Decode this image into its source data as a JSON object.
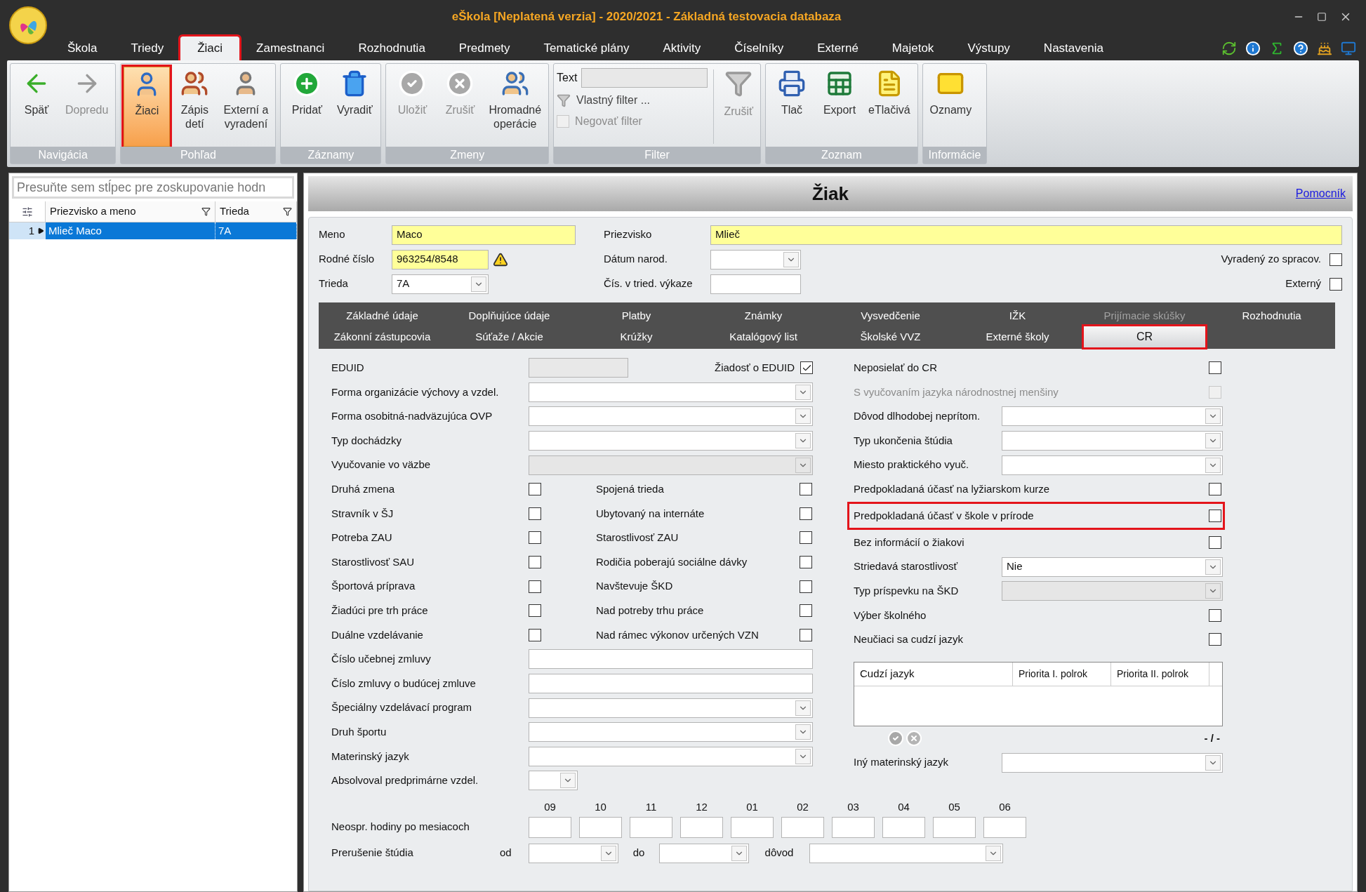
{
  "window": {
    "title": "eŠkola [Neplatená verzia] - 2020/2021 - Základná testovacia databaza"
  },
  "menu": [
    {
      "label": "Škola",
      "selected": false,
      "highlighted": false
    },
    {
      "label": "Triedy",
      "selected": false,
      "highlighted": false
    },
    {
      "label": "Žiaci",
      "selected": true,
      "highlighted": true
    },
    {
      "label": "Zamestnanci",
      "selected": false,
      "highlighted": false
    },
    {
      "label": "Rozhodnutia",
      "selected": false,
      "highlighted": false
    },
    {
      "label": "Predmety",
      "selected": false,
      "highlighted": false
    },
    {
      "label": "Tematické plány",
      "selected": false,
      "highlighted": false
    },
    {
      "label": "Aktivity",
      "selected": false,
      "highlighted": false
    },
    {
      "label": "Číselníky",
      "selected": false,
      "highlighted": false
    },
    {
      "label": "Externé",
      "selected": false,
      "highlighted": false
    },
    {
      "label": "Majetok",
      "selected": false,
      "highlighted": false
    },
    {
      "label": "Výstupy",
      "selected": false,
      "highlighted": false
    },
    {
      "label": "Nastavenia",
      "selected": false,
      "highlighted": false
    }
  ],
  "ribbon": [
    {
      "kind": "buttons",
      "label": "Navigácia",
      "buttons": [
        {
          "label": "Späť",
          "disabled": false,
          "selected": false,
          "highlighted": false
        },
        {
          "label": "Dopredu",
          "disabled": true,
          "selected": false,
          "highlighted": false
        }
      ]
    },
    {
      "kind": "buttons",
      "label": "Pohľad",
      "buttons": [
        {
          "label": "Žiaci",
          "disabled": false,
          "selected": true,
          "highlighted": true
        },
        {
          "label": "Zápis\ndetí",
          "disabled": false,
          "selected": false,
          "highlighted": false
        },
        {
          "label": "Externí a\nvyradení",
          "disabled": false,
          "selected": false,
          "highlighted": false
        }
      ]
    },
    {
      "kind": "buttons",
      "label": "Záznamy",
      "buttons": [
        {
          "label": "Pridať",
          "disabled": false,
          "selected": false,
          "highlighted": false
        },
        {
          "label": "Vyradiť",
          "disabled": false,
          "selected": false,
          "highlighted": false
        }
      ]
    },
    {
      "kind": "buttons",
      "label": "Zmeny",
      "buttons": [
        {
          "label": "Uložiť",
          "disabled": true,
          "selected": false,
          "highlighted": false
        },
        {
          "label": "Zrušiť",
          "disabled": true,
          "selected": false,
          "highlighted": false
        },
        {
          "label": "Hromadné\noperácie",
          "disabled": false,
          "selected": false,
          "highlighted": false
        }
      ]
    },
    {
      "kind": "filter",
      "label": "Filter",
      "text_label": "Text",
      "custom_filter": "Vlastný filter ...",
      "negate": {
        "label": "Negovať filter",
        "checked": false,
        "disabled": true
      },
      "clear": {
        "label": "Zrušiť",
        "disabled": true
      }
    },
    {
      "kind": "buttons",
      "label": "Zoznam",
      "buttons": [
        {
          "label": "Tlač",
          "disabled": false,
          "selected": false,
          "highlighted": false
        },
        {
          "label": "Export",
          "disabled": false,
          "selected": false,
          "highlighted": false
        },
        {
          "label": "eTlačivá",
          "disabled": false,
          "selected": false,
          "highlighted": false
        }
      ]
    },
    {
      "kind": "buttons",
      "label": "Informácie",
      "buttons": [
        {
          "label": "Oznamy",
          "disabled": false,
          "selected": false,
          "highlighted": false
        }
      ]
    }
  ],
  "grid": {
    "group_hint": "Presuňte sem stĺpec pre zoskupovanie hodn",
    "columns": [
      "Priezvisko a meno",
      "Trieda"
    ],
    "rows": [
      {
        "number": "1",
        "cells": [
          "Mlieč Maco",
          "7A"
        ],
        "selected": true
      }
    ]
  },
  "detail": {
    "title": "Žiak",
    "help_link": "Pomocník",
    "header": {
      "first_name": {
        "label": "Meno",
        "value": "Maco"
      },
      "last_name": {
        "label": "Priezvisko",
        "value": "Mlieč"
      },
      "birth_number": {
        "label": "Rodné číslo",
        "value": "963254/8548",
        "warning": true
      },
      "birth_date": {
        "label": "Dátum narod."
      },
      "class": {
        "label": "Trieda",
        "value": "7A"
      },
      "class_number": {
        "label": "Čís. v tried. výkaze"
      },
      "excluded": {
        "label": "Vyradený zo spracov.",
        "checked": false
      },
      "external": {
        "label": "Externý",
        "checked": false
      }
    },
    "tabs": [
      [
        {
          "label": "Základné údaje",
          "selected": false,
          "disabled": false,
          "highlighted": false
        },
        {
          "label": "Doplňujúce údaje",
          "selected": false,
          "disabled": false,
          "highlighted": false
        },
        {
          "label": "Platby",
          "selected": false,
          "disabled": false,
          "highlighted": false
        },
        {
          "label": "Známky",
          "selected": false,
          "disabled": false,
          "highlighted": false
        },
        {
          "label": "Vysvedčenie",
          "selected": false,
          "disabled": false,
          "highlighted": false
        },
        {
          "label": "IŽK",
          "selected": false,
          "disabled": false,
          "highlighted": false
        },
        {
          "label": "Prijímacie skúšky",
          "selected": false,
          "disabled": true,
          "highlighted": false
        },
        {
          "label": "Rozhodnutia",
          "selected": false,
          "disabled": false,
          "highlighted": false
        }
      ],
      [
        {
          "label": "Zákonní zástupcovia",
          "selected": false,
          "disabled": false,
          "highlighted": false
        },
        {
          "label": "Súťaže / Akcie",
          "selected": false,
          "disabled": false,
          "highlighted": false
        },
        {
          "label": "Krúžky",
          "selected": false,
          "disabled": false,
          "highlighted": false
        },
        {
          "label": "Katalógový list",
          "selected": false,
          "disabled": false,
          "highlighted": false
        },
        {
          "label": "Školské VVZ",
          "selected": false,
          "disabled": false,
          "highlighted": false
        },
        {
          "label": "Externé školy",
          "selected": false,
          "disabled": false,
          "highlighted": false
        },
        {
          "label": "CR",
          "selected": true,
          "disabled": false,
          "highlighted": true
        }
      ]
    ]
  },
  "cr": {
    "left_rows": [
      {
        "kind": "id",
        "label": "EDUID",
        "disabled": true,
        "request": {
          "label": "Žiadosť o EDUID",
          "checked": true
        }
      },
      {
        "kind": "dropdown",
        "label": "Forma organizácie výchovy a vzdel.",
        "disabled": false
      },
      {
        "kind": "dropdown",
        "label": "Forma osobitná-nadväzujúca OVP",
        "disabled": false
      },
      {
        "kind": "dropdown",
        "label": "Typ dochádzky",
        "disabled": false
      },
      {
        "kind": "dropdown",
        "label": "Vyučovanie vo väzbe",
        "disabled": true
      },
      {
        "kind": "checks",
        "items": [
          {
            "label": "Druhá zmena",
            "checked": false
          },
          {
            "label": "Spojená trieda",
            "checked": false
          }
        ]
      },
      {
        "kind": "checks",
        "items": [
          {
            "label": "Stravník v ŠJ",
            "checked": false
          },
          {
            "label": "Ubytovaný na internáte",
            "checked": false
          }
        ]
      },
      {
        "kind": "checks",
        "items": [
          {
            "label": "Potreba ZAU",
            "checked": false
          },
          {
            "label": "Starostlivosť ZAU",
            "checked": false
          }
        ]
      },
      {
        "kind": "checks",
        "items": [
          {
            "label": "Starostlivosť SAU",
            "checked": false
          },
          {
            "label": "Rodičia poberajú sociálne dávky",
            "checked": false
          }
        ]
      },
      {
        "kind": "checks",
        "items": [
          {
            "label": "Športová príprava",
            "checked": false
          },
          {
            "label": "Navštevuje ŠKD",
            "checked": false
          }
        ]
      },
      {
        "kind": "checks",
        "items": [
          {
            "label": "Žiadúci pre trh práce",
            "checked": false
          },
          {
            "label": "Nad potreby trhu práce",
            "checked": false
          }
        ]
      },
      {
        "kind": "checks",
        "items": [
          {
            "label": "Duálne vzdelávanie",
            "checked": false
          },
          {
            "label": "Nad rámec výkonov určených VZN",
            "checked": false
          }
        ]
      },
      {
        "kind": "text",
        "label": "Číslo učebnej zmluvy",
        "disabled": false
      },
      {
        "kind": "text",
        "label": "Číslo zmluvy o budúcej zmluve",
        "disabled": false
      },
      {
        "kind": "dropdown",
        "label": "Špeciálny vzdelávací program",
        "disabled": false
      },
      {
        "kind": "dropdown",
        "label": "Druh športu",
        "disabled": false
      },
      {
        "kind": "dropdown",
        "label": "Materinský jazyk",
        "disabled": false
      },
      {
        "kind": "small-dropdown",
        "label": "Absolvoval predprimárne vzdel.",
        "disabled": false
      }
    ],
    "right_rows": [
      {
        "kind": "check",
        "label": "Neposielať do CR",
        "checked": false,
        "disabled": false,
        "highlighted": false
      },
      {
        "kind": "check",
        "label": "S vyučovaním jazyka národnostnej menšiny",
        "checked": false,
        "disabled": true,
        "highlighted": false
      },
      {
        "kind": "dropdown",
        "label": "Dôvod dlhodobej neprítom.",
        "disabled": false,
        "highlighted": false
      },
      {
        "kind": "dropdown",
        "label": "Typ ukončenia štúdia",
        "disabled": false,
        "highlighted": false
      },
      {
        "kind": "dropdown",
        "label": "Miesto praktického vyuč.",
        "disabled": false,
        "highlighted": false
      },
      {
        "kind": "check",
        "label": "Predpokladaná účasť na lyžiarskom kurze",
        "checked": false,
        "disabled": false,
        "highlighted": false
      },
      {
        "kind": "check",
        "label": "Predpokladaná účasť v škole v prírode",
        "checked": false,
        "disabled": false,
        "highlighted": true
      },
      {
        "kind": "check",
        "label": "Bez informácií o žiakovi",
        "checked": false,
        "disabled": false,
        "highlighted": false
      },
      {
        "kind": "dropdown",
        "label": "Striedavá starostlivosť",
        "value": "Nie",
        "disabled": false,
        "highlighted": false
      },
      {
        "kind": "dropdown",
        "label": "Typ príspevku na ŠKD",
        "disabled": true,
        "highlighted": false
      },
      {
        "kind": "check",
        "label": "Výber školného",
        "checked": false,
        "disabled": false,
        "highlighted": false
      },
      {
        "kind": "check",
        "label": "Neučiaci sa cudzí jazyk",
        "checked": false,
        "disabled": false,
        "highlighted": false
      }
    ],
    "language_table": {
      "columns": [
        "Cudzí jazyk",
        "Priorita I. polrok",
        "Priorita II. polrok"
      ],
      "pager": "- / -"
    },
    "other_language": {
      "label": "Iný materinský jazyk"
    },
    "hours": {
      "label": "Neospr. hodiny po mesiacoch",
      "months": [
        "09",
        "10",
        "11",
        "12",
        "01",
        "02",
        "03",
        "04",
        "05",
        "06"
      ]
    },
    "interruption": {
      "label": "Prerušenie štúdia",
      "from": "od",
      "to": "do",
      "reason": "dôvod"
    }
  }
}
